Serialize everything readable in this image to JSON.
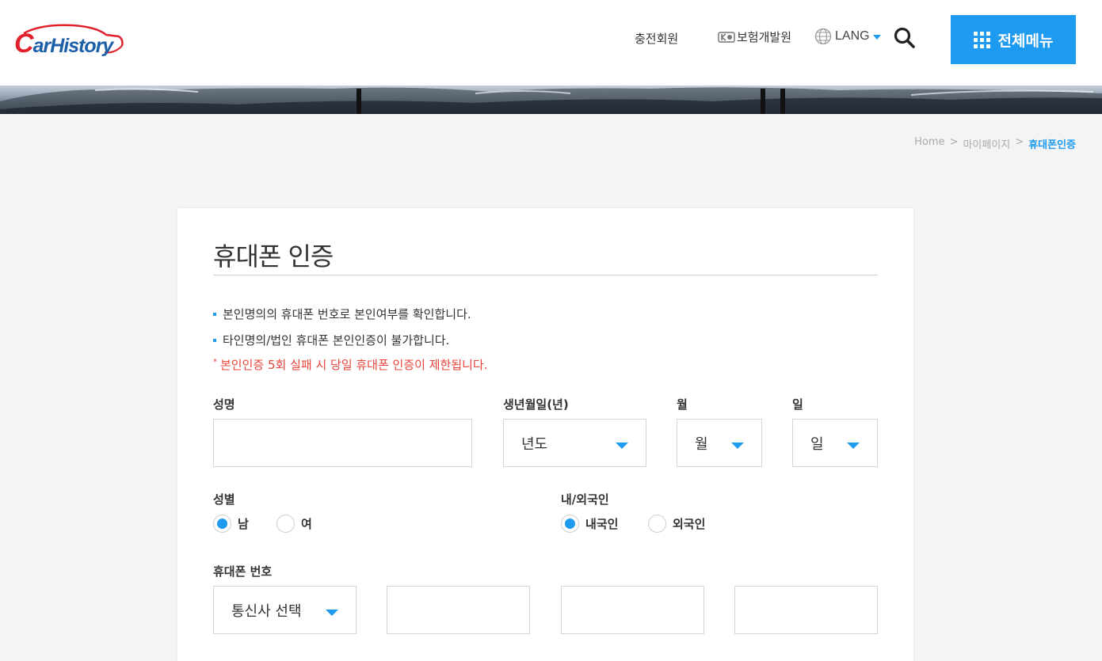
{
  "header": {
    "logo_text_c": "C",
    "logo_text_rest": "arHistory",
    "nav_member": "충전회원",
    "nav_insurance": "보험개발원",
    "nav_lang": "LANG",
    "menu_label": "전체메뉴"
  },
  "breadcrumb": {
    "home": "Home",
    "sep": ">",
    "mypage": "마이페이지",
    "current": "휴대폰인증"
  },
  "form": {
    "title": "휴대폰 인증",
    "notices": [
      "본인명의의 휴대폰 번호로 본인여부를 확인합니다.",
      "타인명의/법인 휴대폰 본인인증이 불가합니다."
    ],
    "warning_mark": "*",
    "warning": "본인인증 5회 실패 시 당일 휴대폰 인증이 제한됩니다.",
    "name_label": "성명",
    "name_value": "",
    "birth_year_label": "생년월일(년)",
    "birth_year_value": "년도",
    "birth_month_label": "월",
    "birth_month_value": "월",
    "birth_day_label": "일",
    "birth_day_value": "일",
    "gender_label": "성별",
    "gender_options": [
      "남",
      "여"
    ],
    "gender_selected": "남",
    "nationality_label": "내/외국인",
    "nationality_options": [
      "내국인",
      "외국인"
    ],
    "nationality_selected": "내국인",
    "phone_label": "휴대폰 번호",
    "carrier_value": "통신사 선택",
    "phone_part1": "",
    "phone_part2": "",
    "phone_part3": ""
  },
  "colors": {
    "accent": "#1e9bf0",
    "warning": "#e8453c",
    "logo_red": "#e0202a",
    "logo_blue": "#1b5fa8"
  },
  "icons": {
    "search": "search-icon",
    "menu": "grid-menu-icon",
    "lang": "globe-icon",
    "insurance": "kidi-logo-icon"
  }
}
